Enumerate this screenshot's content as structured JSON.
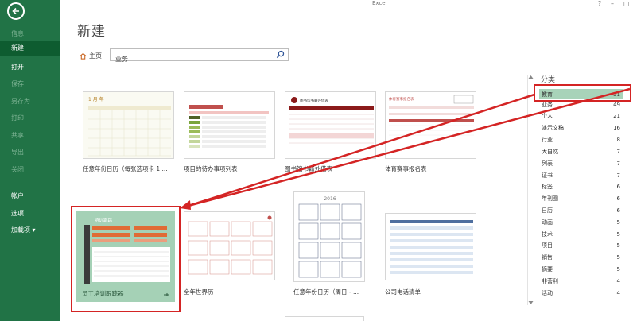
{
  "window": {
    "app_title": "Excel",
    "help": "?",
    "minimize": "–",
    "restore": "□"
  },
  "sidebar": {
    "items": [
      {
        "label": "信息",
        "dim": true
      },
      {
        "label": "新建",
        "active": true
      },
      {
        "label": "打开"
      },
      {
        "label": "保存",
        "dim": true
      },
      {
        "label": "另存为",
        "dim": true
      },
      {
        "label": "打印",
        "dim": true
      },
      {
        "label": "共享",
        "dim": true
      },
      {
        "label": "导出",
        "dim": true
      },
      {
        "label": "关闭",
        "dim": true
      },
      {
        "label": "帐户"
      },
      {
        "label": "选项"
      },
      {
        "label": "加载项 ▾"
      }
    ]
  },
  "main": {
    "heading": "新建",
    "home_label": "主页",
    "search_value": "业务"
  },
  "templates": [
    {
      "label": "任意年份日历（每张选项卡 1 ..."
    },
    {
      "label": "项目的待办事项列表"
    },
    {
      "label": "图书馆书籍外借表"
    },
    {
      "label": "体育赛事报名表"
    },
    {
      "label": "员工培训跟踪器",
      "overlay_title": "培训跟踪"
    },
    {
      "label": "全年世界历"
    },
    {
      "label": "任意年份日历（周日 - ..."
    },
    {
      "label": "公司电话清单"
    }
  ],
  "thumb_text": {
    "cal_title": "1 月 年",
    "lib_title": "图书馆书籍外借表",
    "sport_title": "体育赛事报名表",
    "year": "2016"
  },
  "categories": {
    "title": "分类",
    "items": [
      {
        "name": "教育",
        "count": "51",
        "selected": true
      },
      {
        "name": "业务",
        "count": "49"
      },
      {
        "name": "个人",
        "count": "21"
      },
      {
        "name": "演示文稿",
        "count": "16"
      },
      {
        "name": "行业",
        "count": "8"
      },
      {
        "name": "大自然",
        "count": "7"
      },
      {
        "name": "列表",
        "count": "7"
      },
      {
        "name": "证书",
        "count": "7"
      },
      {
        "name": "标签",
        "count": "6"
      },
      {
        "name": "年刊图",
        "count": "6"
      },
      {
        "name": "日历",
        "count": "6"
      },
      {
        "name": "动画",
        "count": "5"
      },
      {
        "name": "技术",
        "count": "5"
      },
      {
        "name": "项目",
        "count": "5"
      },
      {
        "name": "销售",
        "count": "5"
      },
      {
        "name": "摘要",
        "count": "5"
      },
      {
        "name": "非营利",
        "count": "4"
      },
      {
        "name": "活动",
        "count": "4"
      }
    ]
  },
  "colors": {
    "rail": "#217346",
    "selected_category": "#a8d3b9",
    "annotation": "#d42424"
  }
}
